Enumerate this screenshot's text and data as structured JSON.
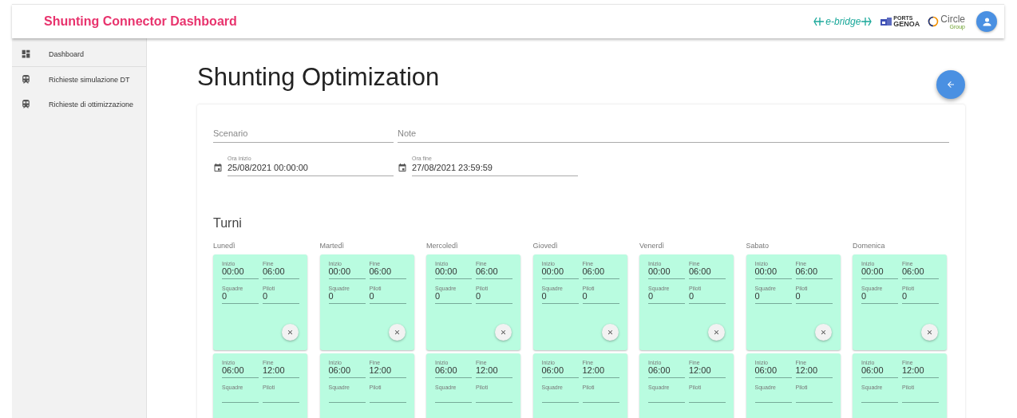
{
  "header": {
    "title": "Shunting Connector Dashboard",
    "logos": [
      {
        "kind": "ebridge",
        "texts": [
          "e-bridge"
        ]
      },
      {
        "kind": "genoa",
        "texts": [
          "PORTS",
          "GENOA"
        ]
      },
      {
        "kind": "circle",
        "texts": [
          "Circle",
          "Group"
        ]
      }
    ]
  },
  "sidebar": {
    "items": [
      {
        "label": "Dashboard",
        "kind": "dashboard"
      },
      {
        "label": "Richieste simulazione DT",
        "kind": "request"
      },
      {
        "label": "Richieste di ottimizzazione",
        "kind": "request"
      }
    ]
  },
  "page": {
    "title": "Shunting Optimization"
  },
  "form": {
    "scenario": {
      "placeholder": "Scenario"
    },
    "note": {
      "placeholder": "Note"
    },
    "start": {
      "label": "Ora inizio",
      "value": "25/08/2021 00:00:00"
    },
    "end": {
      "label": "Ora fine",
      "value": "27/08/2021 23:59:59"
    }
  },
  "shifts": {
    "title": "Turni",
    "days": [
      {
        "name": "Lunedì",
        "turns": [
          {
            "fields": [
              {
                "label": "Inizio",
                "value": "00:00"
              },
              {
                "label": "Fine",
                "value": "06:00"
              },
              {
                "label": "Squadre",
                "value": "0"
              },
              {
                "label": "Piloti",
                "value": "0"
              }
            ]
          },
          {
            "fields": [
              {
                "label": "Inizio",
                "value": "06:00"
              },
              {
                "label": "Fine",
                "value": "12:00"
              },
              {
                "label": "Squadre"
              },
              {
                "label": "Piloti"
              }
            ]
          }
        ]
      },
      {
        "name": "Martedì",
        "turns": [
          {
            "fields": [
              {
                "label": "Inizio",
                "value": "00:00"
              },
              {
                "label": "Fine",
                "value": "06:00"
              },
              {
                "label": "Squadre",
                "value": "0"
              },
              {
                "label": "Piloti",
                "value": "0"
              }
            ]
          },
          {
            "fields": [
              {
                "label": "Inizio",
                "value": "06:00"
              },
              {
                "label": "Fine",
                "value": "12:00"
              },
              {
                "label": "Squadre"
              },
              {
                "label": "Piloti"
              }
            ]
          }
        ]
      },
      {
        "name": "Mercoledì",
        "turns": [
          {
            "fields": [
              {
                "label": "Inizio",
                "value": "00:00"
              },
              {
                "label": "Fine",
                "value": "06:00"
              },
              {
                "label": "Squadre",
                "value": "0"
              },
              {
                "label": "Piloti",
                "value": "0"
              }
            ]
          },
          {
            "fields": [
              {
                "label": "Inizio",
                "value": "06:00"
              },
              {
                "label": "Fine",
                "value": "12:00"
              },
              {
                "label": "Squadre"
              },
              {
                "label": "Piloti"
              }
            ]
          }
        ]
      },
      {
        "name": "Giovedì",
        "turns": [
          {
            "fields": [
              {
                "label": "Inizio",
                "value": "00:00"
              },
              {
                "label": "Fine",
                "value": "06:00"
              },
              {
                "label": "Squadre",
                "value": "0"
              },
              {
                "label": "Piloti",
                "value": "0"
              }
            ]
          },
          {
            "fields": [
              {
                "label": "Inizio",
                "value": "06:00"
              },
              {
                "label": "Fine",
                "value": "12:00"
              },
              {
                "label": "Squadre"
              },
              {
                "label": "Piloti"
              }
            ]
          }
        ]
      },
      {
        "name": "Venerdì",
        "turns": [
          {
            "fields": [
              {
                "label": "Inizio",
                "value": "00:00"
              },
              {
                "label": "Fine",
                "value": "06:00"
              },
              {
                "label": "Squadre",
                "value": "0"
              },
              {
                "label": "Piloti",
                "value": "0"
              }
            ]
          },
          {
            "fields": [
              {
                "label": "Inizio",
                "value": "06:00"
              },
              {
                "label": "Fine",
                "value": "12:00"
              },
              {
                "label": "Squadre"
              },
              {
                "label": "Piloti"
              }
            ]
          }
        ]
      },
      {
        "name": "Sabato",
        "turns": [
          {
            "fields": [
              {
                "label": "Inizio",
                "value": "00:00"
              },
              {
                "label": "Fine",
                "value": "06:00"
              },
              {
                "label": "Squadre",
                "value": "0"
              },
              {
                "label": "Piloti",
                "value": "0"
              }
            ]
          },
          {
            "fields": [
              {
                "label": "Inizio",
                "value": "06:00"
              },
              {
                "label": "Fine",
                "value": "12:00"
              },
              {
                "label": "Squadre"
              },
              {
                "label": "Piloti"
              }
            ]
          }
        ]
      },
      {
        "name": "Domenica",
        "turns": [
          {
            "fields": [
              {
                "label": "Inizio",
                "value": "00:00"
              },
              {
                "label": "Fine",
                "value": "06:00"
              },
              {
                "label": "Squadre",
                "value": "0"
              },
              {
                "label": "Piloti",
                "value": "0"
              }
            ]
          },
          {
            "fields": [
              {
                "label": "Inizio",
                "value": "06:00"
              },
              {
                "label": "Fine",
                "value": "12:00"
              },
              {
                "label": "Squadre"
              },
              {
                "label": "Piloti"
              }
            ]
          }
        ]
      }
    ]
  }
}
